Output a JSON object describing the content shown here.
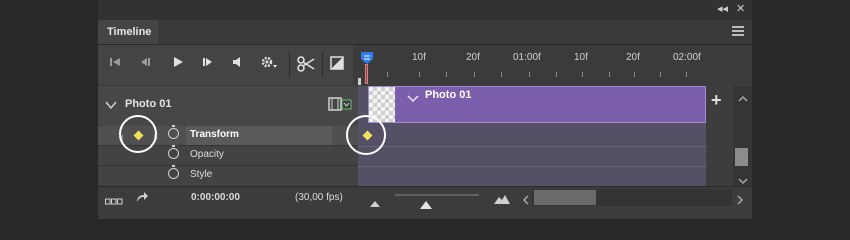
{
  "window": {
    "collapse_label": "◂◂",
    "close_label": "✕"
  },
  "tab": {
    "label": "Timeline"
  },
  "ruler": {
    "ticks": [
      "10f",
      "20f",
      "01:00f",
      "10f",
      "20f",
      "02:00f"
    ]
  },
  "layer": {
    "name": "Photo 01",
    "clip_label": "Photo 01"
  },
  "properties": [
    {
      "label": "Transform",
      "selected": true
    },
    {
      "label": "Opacity",
      "selected": false
    },
    {
      "label": "Style",
      "selected": false
    }
  ],
  "add_button": {
    "label": "+"
  },
  "bottom": {
    "timecode": "0:00:00:00",
    "fps": "(30,00 fps)"
  },
  "colors": {
    "clip": "#7b5fac",
    "keyframe": "#f1e05a",
    "playhead": "#2e7cf0"
  }
}
